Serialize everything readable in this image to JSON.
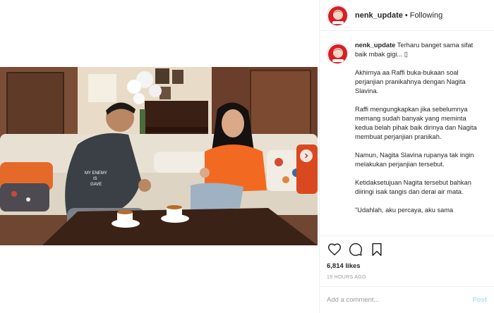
{
  "post": {
    "username": "nenk_update",
    "separator": "•",
    "follow_status": "Following",
    "caption_first": "Terharu banget sama sifat baik mbak gigi... ",
    "caption_emoji": "▯",
    "paragraphs": [
      "Akhirnya aa Raffi buka-bukaan soal perjanjian pranikahnya dengan Nagita Slavina.",
      "Raffi mengungkapkan jika sebelumnya memang sudah banyak yang meminta kedua belah pihak baik dirinya dan Nagita membuat perjanjian pranikah.",
      "Namun, Nagita Slavina rupanya tak ingin melakukan perjanjian tersebut.",
      "Ketidaksetujuan Nagita tersebut bahkan diiringi isak tangis dan derai air mata.",
      "\"Udahlah, aku percaya, aku sama"
    ],
    "likes": "6,814 likes",
    "time": "19 HOURS AGO"
  },
  "comment": {
    "placeholder": "Add a comment...",
    "post_label": "Post"
  },
  "photo": {
    "jacket_text_line1": "MY ENEMY",
    "jacket_text_line2": "IS",
    "jacket_text_line3": "GAVE"
  },
  "icons": {
    "like": "heart-icon",
    "comment": "speech-bubble-icon",
    "save": "bookmark-icon",
    "next": "chevron-right-icon"
  },
  "colors": {
    "orange_top": "#f26a21",
    "sofa": "#e9e2d6",
    "post_button": "#b2dffc",
    "avatar_red": "#d81f26"
  }
}
